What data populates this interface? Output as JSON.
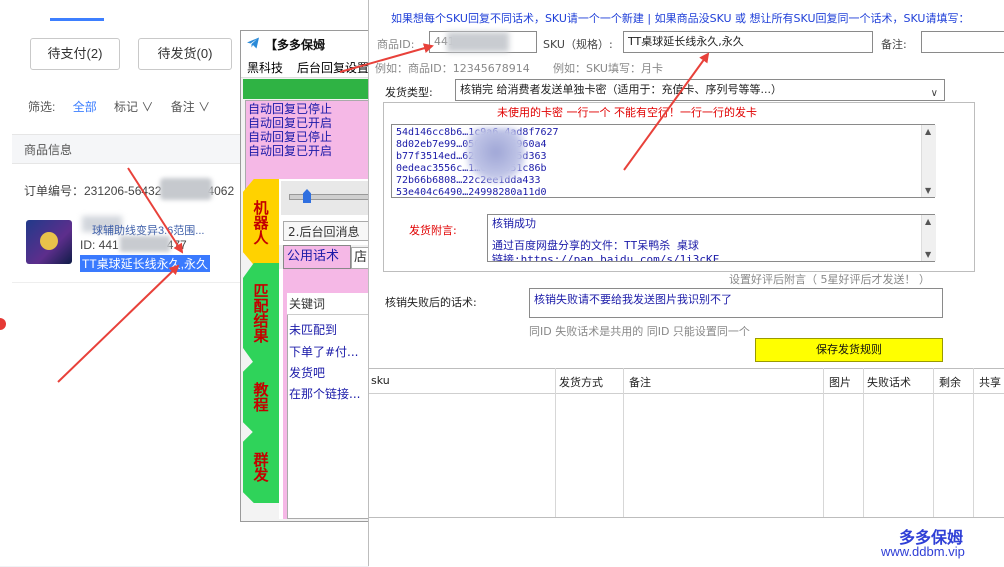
{
  "colors": {
    "accent_blue": "#3d7fff",
    "pink_panel": "#f5b8e6",
    "text_blue": "#1a1aa8",
    "red": "#e00000",
    "save_yellow": "#ffff00",
    "green_bar": "#2fb344"
  },
  "order_page": {
    "buttons": [
      "待支付(2)",
      "待发货(0)"
    ],
    "filter_label": "筛选:",
    "filter_all": "全部",
    "filter_tag": "标记 ∨",
    "filter_note": "备注 ∨",
    "header_product_info": "商品信息",
    "order_number_label": "订单编号：231206-56432",
    "order_number_tail": "4062",
    "item_title": "球辅助线变异3.6范围...",
    "item_id_prefix": "ID: 441",
    "item_id_suffix": "477",
    "item_sku": "TT桌球延长线永久,永久"
  },
  "mid_window": {
    "title": "【多多保姆",
    "menu": [
      "黑科技",
      "后台回复设置"
    ],
    "log_lines": [
      "自动回复已停止",
      "自动回复已开启",
      "自动回复已停止",
      "自动回复已开启"
    ],
    "vertical_tabs": [
      "机器人",
      "匹配结果",
      "教程",
      "群发"
    ],
    "subtab": "2.后台回消息",
    "tab_active": "公用话术",
    "tab_2": "店",
    "keyword_header": "关键词",
    "keywords": [
      "未匹配到",
      "下单了#付...",
      "发货吧",
      "在那个链接..."
    ]
  },
  "rule_window": {
    "top_note": "如果想每个SKU回复不同话术，SKU请一个一个新建 | 如果商品没SKU 或 想让所有SKU回复同一个话术，SKU请填写：",
    "product_id_label": "商品ID:",
    "product_id_value": "441",
    "sku_label": "SKU（规格）:",
    "sku_value": "TT桌球延长线永久,永久",
    "note_label": "备注:",
    "product_id_example": "例如：商品ID：12345678914",
    "sku_example": "例如：SKU填写：月卡",
    "ship_type_label": "发货类型:",
    "ship_type_value": "核销完 给消费者发送单独卡密（适用于：充值卡、序列号等等...）",
    "unused_keys_title": "未使用的卡密 一行一个 不能有空行！一行一行的发卡",
    "keys": [
      "54d146cc8b6…1c9a6…4ad8f7627",
      "8d02eb7e99…0569…60e6960a4",
      "b77f3514ed…626…b38f85d363",
      "0edeac3556c…1…c4b9951c86b",
      "72b66b6808…22c2ee1dda433",
      "53e404c6490…24998280a11d0"
    ],
    "attach_label": "发货附言:",
    "attach_lines": [
      "核销成功",
      "",
      "通过百度网盘分享的文件：TT呆鸭杀 桌球",
      "链接:https://pan.baidu.com/s/1i3cKF…"
    ],
    "good_review_note": "设置好评后附言（ 5星好评后才发送！ ）",
    "fail_label": "核销失败后的话术:",
    "fail_value": "核销失败请不要给我发送图片我识别不了",
    "fail_hint": "同ID 失败话术是共用的 同ID 只能设置同一个",
    "save_button": "保存发货规则",
    "table_headers": [
      "sku",
      "发货方式",
      "备注",
      "图片",
      "失败话术",
      "剩余",
      "共享"
    ],
    "watermark_name": "多多保姆",
    "watermark_url": "www.ddbm.vip"
  }
}
